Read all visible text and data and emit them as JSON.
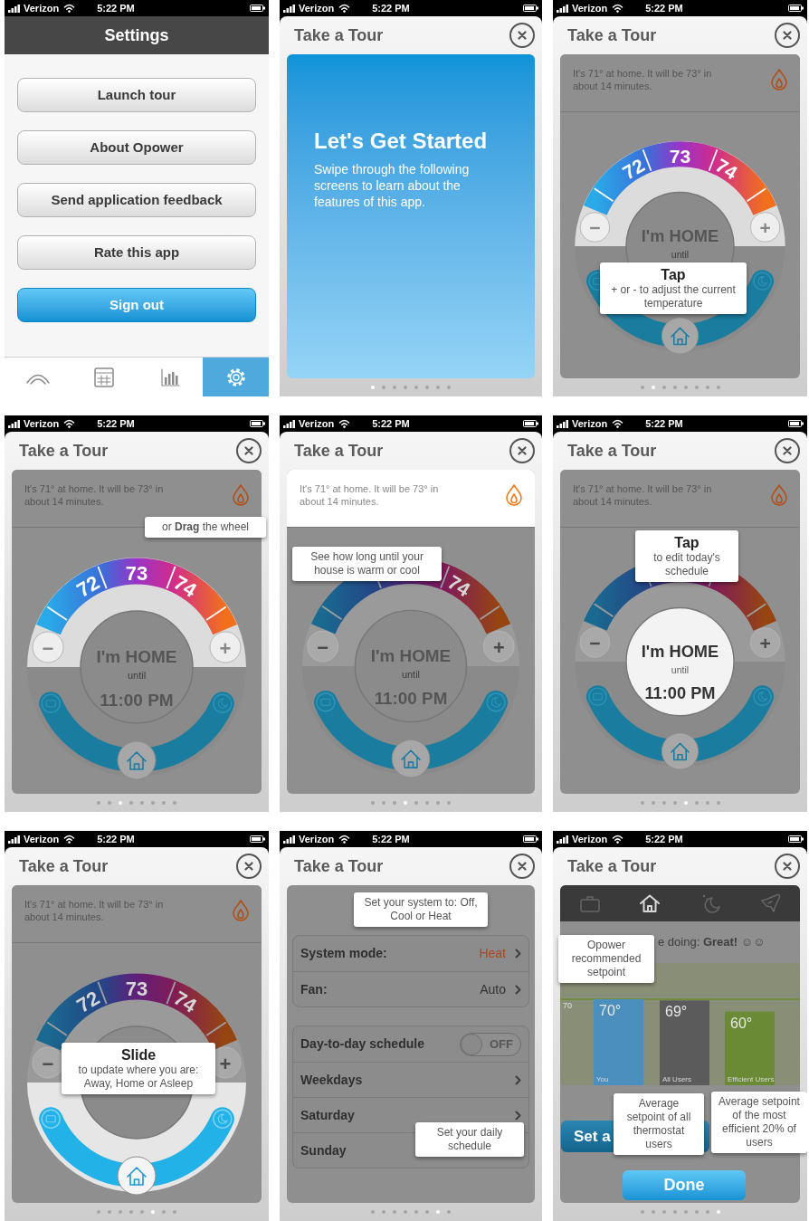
{
  "screens": [
    {
      "kind": "settings",
      "status": {
        "carrier": "Verizon",
        "time": "5:22 PM"
      },
      "title": "Settings",
      "buttons": [
        {
          "label": "Launch tour",
          "primary": false
        },
        {
          "label": "About Opower",
          "primary": false
        },
        {
          "label": "Send application feedback",
          "primary": false
        },
        {
          "label": "Rate this app",
          "primary": false
        },
        {
          "label": "Sign out",
          "primary": true
        }
      ],
      "tabs": [
        {
          "kind": "dial",
          "selected": false
        },
        {
          "kind": "calendar",
          "selected": false
        },
        {
          "kind": "chart",
          "selected": false
        },
        {
          "kind": "settings",
          "selected": true
        }
      ]
    },
    {
      "kind": "intro",
      "status": {
        "carrier": "Verizon",
        "time": "5:22 PM"
      },
      "title": "Take a Tour",
      "heading": "Let's Get Started",
      "body": "Swipe through the following screens to learn about the features of this app.",
      "page_dots": [
        {
          "selected": true
        },
        {
          "selected": false
        },
        {
          "selected": false
        },
        {
          "selected": false
        },
        {
          "selected": false
        },
        {
          "selected": false
        },
        {
          "selected": false
        },
        {
          "selected": false
        }
      ]
    },
    {
      "kind": "dial",
      "status": {
        "carrier": "Verizon",
        "time": "5:22 PM"
      },
      "title": "Take a Tour",
      "info": {
        "text": "It's 71° at home. It will be 73° in about 14 minutes.",
        "highlighted": false
      },
      "dial": {
        "labels": [
          "72",
          "73",
          "74"
        ],
        "minus": "−",
        "plus": "+",
        "center": [
          "I'm HOME",
          "until"
        ],
        "wheel_highlighted": true,
        "center_highlighted": false,
        "slider": {
          "highlighted": false
        }
      },
      "callout": {
        "kind": "buttons",
        "title": "Tap",
        "text": "+ or - to adjust the current temperature"
      },
      "page_dots": [
        {
          "selected": false
        },
        {
          "selected": true
        },
        {
          "selected": false
        },
        {
          "selected": false
        },
        {
          "selected": false
        },
        {
          "selected": false
        },
        {
          "selected": false
        },
        {
          "selected": false
        }
      ]
    },
    {
      "kind": "dial",
      "status": {
        "carrier": "Verizon",
        "time": "5:22 PM"
      },
      "title": "Take a Tour",
      "info": {
        "text": "It's 71° at home. It will be 73° in about 14 minutes.",
        "highlighted": false
      },
      "dial": {
        "labels": [
          "72",
          "73",
          "74"
        ],
        "minus": "−",
        "plus": "+",
        "center": [
          "I'm HOME",
          "until",
          "11:00 PM"
        ],
        "wheel_highlighted": true,
        "center_highlighted": false,
        "slider": {
          "highlighted": false
        }
      },
      "callout": {
        "kind": "wheel",
        "text": "or **Drag** the wheel"
      },
      "page_dots": [
        {
          "selected": false
        },
        {
          "selected": false
        },
        {
          "selected": true
        },
        {
          "selected": false
        },
        {
          "selected": false
        },
        {
          "selected": false
        },
        {
          "selected": false
        },
        {
          "selected": false
        }
      ]
    },
    {
      "kind": "dial",
      "status": {
        "carrier": "Verizon",
        "time": "5:22 PM"
      },
      "title": "Take a Tour",
      "info": {
        "text": "It's 71° at home. It will be 73° in about 14 minutes.",
        "highlighted": true
      },
      "dial": {
        "labels": [
          "74"
        ],
        "minus": "−",
        "plus": "+",
        "center": [
          "I'm HOME",
          "until",
          "11:00 PM"
        ],
        "wheel_highlighted": false,
        "center_highlighted": false,
        "slider": {
          "highlighted": false
        }
      },
      "callout": {
        "kind": "info",
        "text": "See how long until your house is warm or cool"
      },
      "page_dots": [
        {
          "selected": false
        },
        {
          "selected": false
        },
        {
          "selected": false
        },
        {
          "selected": true
        },
        {
          "selected": false
        },
        {
          "selected": false
        },
        {
          "selected": false
        },
        {
          "selected": false
        }
      ]
    },
    {
      "kind": "dial",
      "status": {
        "carrier": "Verizon",
        "time": "5:22 PM"
      },
      "title": "Take a Tour",
      "info": {
        "text": "It's 71° at home. It will be 73° in about 14 minutes.",
        "highlighted": false
      },
      "dial": {
        "minus": "−",
        "plus": "+",
        "center": [
          "I'm HOME",
          "until",
          "11:00 PM"
        ],
        "wheel_highlighted": false,
        "center_highlighted": true,
        "slider": {
          "highlighted": false
        }
      },
      "callout": {
        "kind": "center",
        "title": "Tap",
        "text": "to edit today's schedule"
      },
      "page_dots": [
        {
          "selected": false
        },
        {
          "selected": false
        },
        {
          "selected": false
        },
        {
          "selected": false
        },
        {
          "selected": true
        },
        {
          "selected": false
        },
        {
          "selected": false
        },
        {
          "selected": false
        }
      ]
    },
    {
      "kind": "dial",
      "status": {
        "carrier": "Verizon",
        "time": "5:22 PM"
      },
      "title": "Take a Tour",
      "info": {
        "text": "It's 71° at home. It will be 73° in about 14 minutes.",
        "highlighted": false
      },
      "dial": {
        "labels": [
          "72",
          "73",
          "74"
        ],
        "minus": "−",
        "plus": "+",
        "wheel_highlighted": false,
        "center_highlighted": false,
        "slider": {
          "highlighted": true
        }
      },
      "callout": {
        "kind": "slider",
        "title": "Slide",
        "text": "to update where you are: Away, Home or Asleep"
      },
      "page_dots": [
        {
          "selected": false
        },
        {
          "selected": false
        },
        {
          "selected": false
        },
        {
          "selected": false
        },
        {
          "selected": false
        },
        {
          "selected": true
        },
        {
          "selected": false
        },
        {
          "selected": false
        }
      ]
    },
    {
      "kind": "system",
      "status": {
        "carrier": "Verizon",
        "time": "5:22 PM"
      },
      "title": "Take a Tour",
      "groups": [
        {
          "rows": [
            {
              "kind": "link",
              "label": "System mode:",
              "value": "Heat",
              "accent": true
            },
            {
              "kind": "link",
              "label": "Fan:",
              "value": "Auto",
              "accent": false
            }
          ]
        },
        {
          "rows": [
            {
              "kind": "toggle",
              "label": "Day-to-day schedule",
              "on": false,
              "value": "OFF"
            },
            {
              "kind": "link",
              "label": "Weekdays"
            },
            {
              "kind": "link",
              "label": "Saturday"
            },
            {
              "kind": "label",
              "label": "Sunday"
            }
          ]
        }
      ],
      "callouts": [
        {
          "text": "Set your system to: Off, Cool or Heat"
        },
        {
          "text": "Set your daily schedule"
        }
      ],
      "page_dots": [
        {
          "selected": false
        },
        {
          "selected": false
        },
        {
          "selected": false
        },
        {
          "selected": false
        },
        {
          "selected": false
        },
        {
          "selected": false
        },
        {
          "selected": true
        },
        {
          "selected": false
        }
      ]
    },
    {
      "kind": "chart",
      "status": {
        "carrier": "Verizon",
        "time": "5:22 PM"
      },
      "title": "Take a Tour",
      "modes": [
        {
          "kind": "briefcase",
          "selected": false
        },
        {
          "kind": "home",
          "selected": true
        },
        {
          "kind": "moon",
          "selected": false
        },
        {
          "kind": "plane",
          "selected": false
        }
      ],
      "message": "e doing: **Great!** ☺☺",
      "chart_data": {
        "type": "bar",
        "categories": [
          "You",
          "All Users",
          "Efficient Users"
        ],
        "series": [
          {
            "color": "#4a8fbd",
            "values": [
              70,
              null,
              null
            ],
            "value_labels": [
              "70°",
              null,
              null
            ]
          },
          {
            "color": "#5b5b5b",
            "values": [
              null,
              69,
              null
            ],
            "value_labels": [
              null,
              "69°",
              null
            ]
          },
          {
            "color": "#6a8a36",
            "values": [
              null,
              null,
              60
            ],
            "value_labels": [
              null,
              null,
              "60°"
            ]
          }
        ],
        "annotations": [
          "70"
        ]
      },
      "callouts": [
        {
          "text": "Opower recommended setpoint"
        },
        {
          "text": "Average setpoint of all thermostat users"
        },
        {
          "text": "Average setpoint of the most efficient 20% of users"
        }
      ],
      "secondary_button": "Set a",
      "done_button": "Done",
      "page_dots": [
        {
          "selected": false
        },
        {
          "selected": false
        },
        {
          "selected": false
        },
        {
          "selected": false
        },
        {
          "selected": false
        },
        {
          "selected": false
        },
        {
          "selected": false
        },
        {
          "selected": true
        }
      ]
    }
  ]
}
